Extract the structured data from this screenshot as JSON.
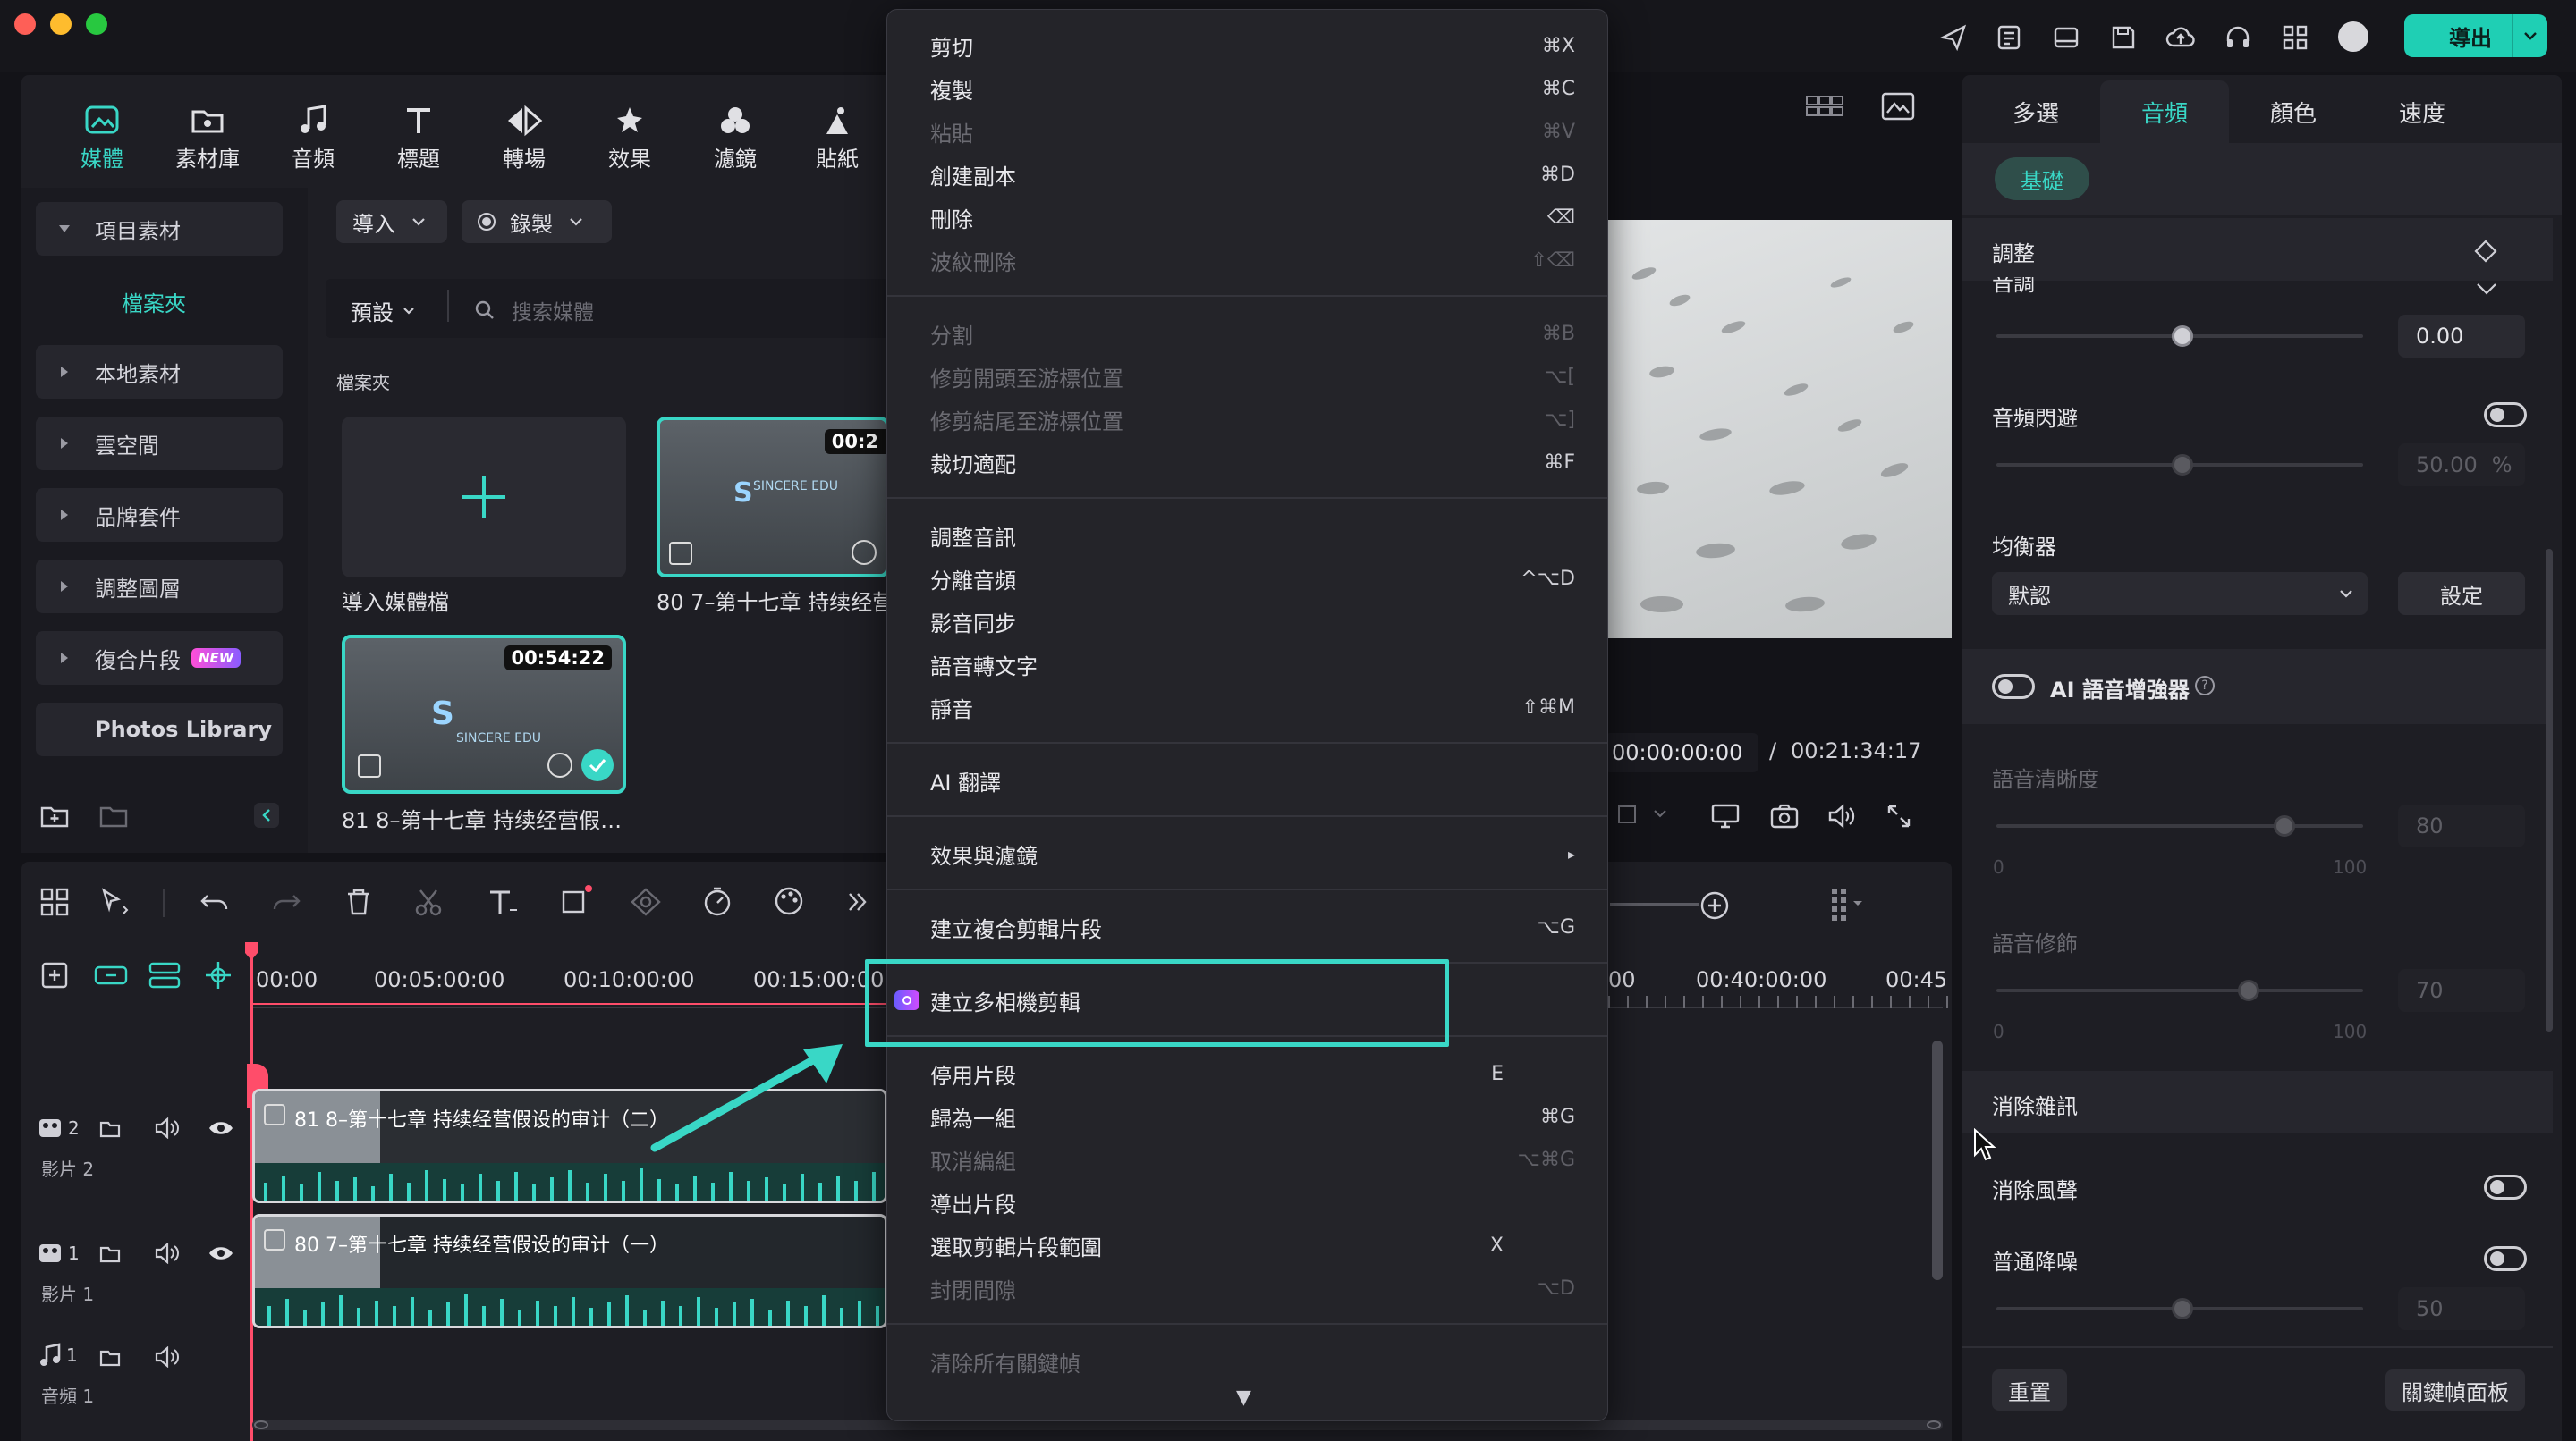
{
  "window": {
    "accent": "#39d7c6",
    "highlight": "#39d7c6",
    "export_color": "#1fcfb4"
  },
  "topbar": {
    "export_label": "導出",
    "icons": [
      "send-icon",
      "task-list-icon",
      "layout-icon",
      "save-icon",
      "cloud-upload-icon",
      "headset-icon",
      "grid-apps-icon",
      "avatar"
    ]
  },
  "toolbar": {
    "items": [
      {
        "label": "媒體",
        "icon": "media-icon"
      },
      {
        "label": "素材庫",
        "icon": "library-icon"
      },
      {
        "label": "音頻",
        "icon": "music-icon"
      },
      {
        "label": "標題",
        "icon": "title-icon"
      },
      {
        "label": "轉場",
        "icon": "transition-icon"
      },
      {
        "label": "效果",
        "icon": "effects-icon"
      },
      {
        "label": "濾鏡",
        "icon": "filters-icon"
      },
      {
        "label": "貼紙",
        "icon": "stickers-icon"
      }
    ]
  },
  "sidebar": {
    "items": [
      {
        "label": "項目素材"
      },
      {
        "label": "檔案夾"
      },
      {
        "label": "本地素材"
      },
      {
        "label": "雲空間"
      },
      {
        "label": "品牌套件"
      },
      {
        "label": "調整圖層"
      },
      {
        "label": "復合片段"
      },
      {
        "label": "Photos Library"
      }
    ],
    "new_badge": "NEW"
  },
  "media": {
    "import_label": "導入",
    "record_label": "錄製",
    "preset_label": "預設",
    "search_placeholder": "搜索媒體",
    "folder_label": "檔案夾",
    "import_card_label": "導入媒體檔",
    "clip1": {
      "duration": "00:2",
      "title": "80 7–第十七章 持续经营",
      "logo": "SINCERE EDU"
    },
    "clip2": {
      "duration": "00:54:22",
      "title": "81 8–第十七章 持续经营假…",
      "logo": "SINCERE EDU"
    }
  },
  "preview": {
    "current_time": "00:00:00:00",
    "separator": "/",
    "total_time": "00:21:34:17"
  },
  "timeline": {
    "ruler": [
      "00:00",
      "00:05:00:00",
      "00:10:00:00",
      "00:15:00:00",
      "00",
      "00:40:00:00",
      "00:45"
    ],
    "tracks": [
      {
        "num": "2",
        "name": "影片 2",
        "clip": "81 8–第十七章 持续经营假设的审计（二）"
      },
      {
        "num": "1",
        "name": "影片 1",
        "clip": "80 7–第十七章 持续经营假设的审计（一）"
      },
      {
        "num": "1",
        "name": "音頻 1"
      }
    ]
  },
  "context_menu": {
    "items": [
      {
        "label": "剪切",
        "shortcut": "⌘X",
        "disabled": false
      },
      {
        "label": "複製",
        "shortcut": "⌘C",
        "disabled": false
      },
      {
        "label": "粘貼",
        "shortcut": "⌘V",
        "disabled": true
      },
      {
        "label": "創建副本",
        "shortcut": "⌘D",
        "disabled": false
      },
      {
        "label": "刪除",
        "shortcut": "⌫",
        "disabled": false
      },
      {
        "label": "波紋刪除",
        "shortcut": "⇧⌫",
        "disabled": true
      },
      {
        "label": "分割",
        "shortcut": "⌘B",
        "disabled": true
      },
      {
        "label": "修剪開頭至游標位置",
        "shortcut": "⌥[",
        "disabled": true
      },
      {
        "label": "修剪結尾至游標位置",
        "shortcut": "⌥]",
        "disabled": true
      },
      {
        "label": "裁切適配",
        "shortcut": "⌘F",
        "disabled": false
      },
      {
        "label": "調整音訊",
        "shortcut": "",
        "disabled": false
      },
      {
        "label": "分離音頻",
        "shortcut": "^⌥D",
        "disabled": false
      },
      {
        "label": "影音同步",
        "shortcut": "",
        "disabled": false
      },
      {
        "label": "語音轉文字",
        "shortcut": "",
        "disabled": false
      },
      {
        "label": "靜音",
        "shortcut": "⇧⌘M",
        "disabled": false
      },
      {
        "label": "AI 翻譯",
        "shortcut": "",
        "disabled": false
      },
      {
        "label": "效果與濾鏡",
        "shortcut": "▸",
        "disabled": false
      },
      {
        "label": "建立複合剪輯片段",
        "shortcut": "⌥G",
        "disabled": false
      },
      {
        "label": "建立多相機剪輯",
        "shortcut": "",
        "disabled": false
      },
      {
        "label": "停用片段",
        "shortcut": "E",
        "disabled": false
      },
      {
        "label": "歸為一組",
        "shortcut": "⌘G",
        "disabled": false
      },
      {
        "label": "取消編組",
        "shortcut": "⌥⌘G",
        "disabled": true
      },
      {
        "label": "導出片段",
        "shortcut": "",
        "disabled": false
      },
      {
        "label": "選取剪輯片段範圍",
        "shortcut": "X",
        "disabled": false
      },
      {
        "label": "封閉間隙",
        "shortcut": "⌥D",
        "disabled": true
      },
      {
        "label": "清除所有關鍵幀",
        "shortcut": "",
        "disabled": true
      }
    ],
    "more_arrow": "▼"
  },
  "right_panel": {
    "tabs": [
      "多選",
      "音頻",
      "顏色",
      "速度"
    ],
    "basic_label": "基礎",
    "adjust_label": "調整",
    "pitch_partial": "音調",
    "pitch_value": "0.00",
    "ducking_label": "音頻閃避",
    "ducking_value": "50.00",
    "ducking_unit": "%",
    "eq_label": "均衡器",
    "eq_select": "默認",
    "eq_button": "設定",
    "ai_enhancer_label": "AI 語音增強器",
    "clarity_label": "語音清晰度",
    "clarity_value": "80",
    "clarity_min": "0",
    "clarity_max": "100",
    "beautify_label": "語音修飾",
    "beautify_value": "70",
    "beautify_min": "0",
    "beautify_max": "100",
    "denoise_header": "消除雜訊",
    "wind_label": "消除風聲",
    "normal_label": "普通降噪",
    "normal_value": "50",
    "reset_button": "重置",
    "keyframe_button": "關鍵幀面板"
  }
}
